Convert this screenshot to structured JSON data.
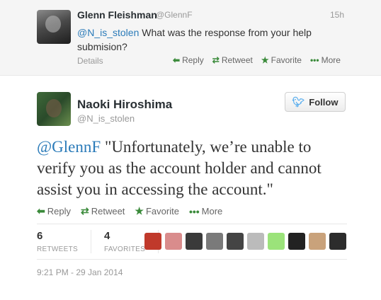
{
  "context_tweet": {
    "name": "Glenn Fleishman",
    "handle": "@GlennF",
    "time": "15h",
    "mention": "@N_is_stolen",
    "text": " What was the response from your help submision?",
    "details_label": "Details",
    "actions": {
      "reply": "Reply",
      "retweet": "Retweet",
      "favorite": "Favorite",
      "more": "More"
    }
  },
  "main_tweet": {
    "name": "Naoki Hiroshima",
    "handle": "@N_is_stolen",
    "follow_label": "Follow",
    "mention": "@GlennF",
    "text": " \"Unfortunately, we’re unable to verify you as the account holder and cannot assist you in accessing the account.\"",
    "actions": {
      "reply": "Reply",
      "retweet": "Retweet",
      "favorite": "Favorite",
      "more": "More"
    },
    "stats": {
      "retweets_count": "6",
      "retweets_label": "RETWEETS",
      "favorites_count": "4",
      "favorites_label": "FAVORITES"
    },
    "datetime": "9:21 PM - 29 Jan 2014"
  },
  "icons": {
    "reply": "reply-arrow-icon",
    "retweet": "retweet-icon",
    "favorite": "star-icon",
    "more": "more-dots-icon",
    "follow": "twitter-bird-icon"
  },
  "colors": {
    "link": "#2b7bb9",
    "action_green": "#3a8a3a",
    "bird_blue": "#55acee"
  },
  "face_colors": [
    "#c0392b",
    "#d98c8c",
    "#3a3a3a",
    "#7a7a7a",
    "#444444",
    "#bbbbbb",
    "#9be37a",
    "#222222",
    "#c9a27b",
    "#2c2c2c"
  ]
}
